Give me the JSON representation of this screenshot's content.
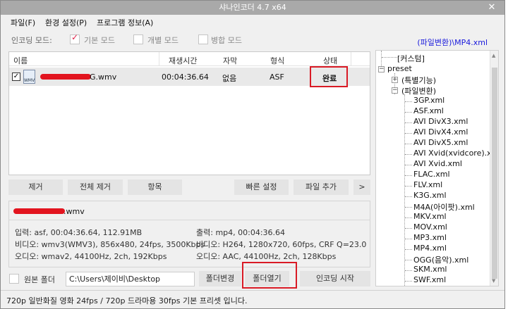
{
  "window": {
    "title": "샤나인코더 4.7 x64",
    "close_glyph": "✕"
  },
  "menu": [
    "파일(F)",
    "환경 설정(P)",
    "프로그램 정보(A)"
  ],
  "mode": {
    "label": "인코딩 모드:",
    "options": [
      {
        "label": "기본 모드",
        "checked": true
      },
      {
        "label": "개별 모드",
        "checked": false
      },
      {
        "label": "병합 모드",
        "checked": false
      }
    ],
    "preset_link": "(파일변환)\\MP4.xml"
  },
  "file_list": {
    "columns": [
      "이름",
      "재생시간",
      "자막",
      "형식",
      "상태"
    ],
    "rows": [
      {
        "checked": true,
        "icon": "wmv-file-icon",
        "icon_text": "WMV",
        "name_suffix": "G.wmv",
        "duration": "00:04:36.64",
        "subtitle": "없음",
        "format": "ASF",
        "status": "완료"
      }
    ]
  },
  "buttons": {
    "remove": "제거",
    "remove_all": "전체 제거",
    "item": "항목",
    "quick_settings": "빠른 설정",
    "add_file": "파일 추가",
    "more": ">"
  },
  "info": {
    "filename_suffix": ".wmv",
    "input": "입력: asf, 00:04:36.64, 112.91MB",
    "input_video": "비디오: wmv3(WMV3), 856x480, 24fps, 3500Kbps",
    "input_audio": "오디오: wmav2, 44100Hz, 2ch, 192Kbps",
    "output": "출력: mp4, 00:04:36.64",
    "output_video": "비디오: H264, 1280x720, 60fps, CRF Q=23.0",
    "output_audio": "오디오: AAC, 44100Hz, 2ch, 128Kbps"
  },
  "bottom": {
    "source_folder_label": "원본 폴더",
    "folder_path": "C:\\Users\\제이비\\Desktop",
    "change_folder": "폴더변경",
    "open_folder": "폴더열기",
    "start_encoding": "인코딩 시작"
  },
  "status_text": "720p 일반화질 영화 24fps   /  720p 드라마용 30fps 기본 프리셋 입니다.",
  "tree": {
    "top_item": "[커스텀]",
    "root": "preset",
    "groups": [
      "(특별기능)",
      "(파일변환)"
    ],
    "files": [
      "3GP.xml",
      "ASF.xml",
      "AVI DivX3.xml",
      "AVI DivX4.xml",
      "AVI DivX5.xml",
      "AVI Xvid(xvidcore).xml",
      "AVI Xvid.xml",
      "FLAC.xml",
      "FLV.xml",
      "K3G.xml",
      "M4A(아이팟).xml",
      "MKV.xml",
      "MOV.xml",
      "MP3.xml",
      "MP4.xml",
      "OGG(음악).xml",
      "SKM.xml",
      "SWF.xml"
    ]
  },
  "colors": {
    "highlight_red": "#d91a25",
    "link_blue": "#1a1adc",
    "check_pink": "#e0224a"
  }
}
